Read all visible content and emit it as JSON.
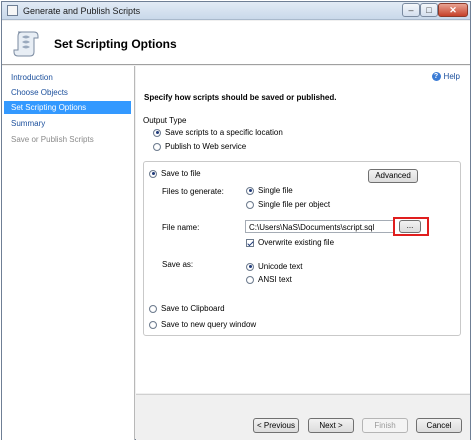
{
  "window": {
    "title": "Generate and Publish Scripts"
  },
  "header": {
    "title": "Set Scripting Options"
  },
  "sidebar": {
    "items": [
      {
        "label": "Introduction",
        "state": "link"
      },
      {
        "label": "Choose Objects",
        "state": "link"
      },
      {
        "label": "Set Scripting Options",
        "state": "active"
      },
      {
        "label": "Summary",
        "state": "link"
      },
      {
        "label": "Save or Publish Scripts",
        "state": "disabled"
      }
    ]
  },
  "main": {
    "help_label": "Help",
    "instruction": "Specify how scripts should be saved or published.",
    "output_type": {
      "label": "Output Type",
      "options": [
        {
          "label": "Save scripts to a specific location",
          "selected": true
        },
        {
          "label": "Publish to Web service",
          "selected": false
        }
      ]
    },
    "save_to_file": {
      "label": "Save to file",
      "selected": true,
      "advanced_button": "Advanced",
      "files_to_generate": {
        "label": "Files to generate:",
        "options": [
          {
            "label": "Single file",
            "selected": true
          },
          {
            "label": "Single file per object",
            "selected": false
          }
        ]
      },
      "file_name": {
        "label": "File name:",
        "value": "C:\\Users\\NaS\\Documents\\script.sql",
        "browse_button": "..."
      },
      "overwrite": {
        "label": "Overwrite existing file",
        "checked": true
      },
      "save_as": {
        "label": "Save as:",
        "options": [
          {
            "label": "Unicode text",
            "selected": true
          },
          {
            "label": "ANSI text",
            "selected": false
          }
        ]
      }
    },
    "save_to_clipboard": {
      "label": "Save to Clipboard",
      "selected": false
    },
    "save_to_query_window": {
      "label": "Save to new query window",
      "selected": false
    }
  },
  "footer": {
    "previous": "< Previous",
    "next": "Next >",
    "finish": "Finish",
    "cancel": "Cancel"
  },
  "colors": {
    "active_nav": "#3399ff",
    "link": "#1b4f9c",
    "highlight": "#e01e1e"
  }
}
